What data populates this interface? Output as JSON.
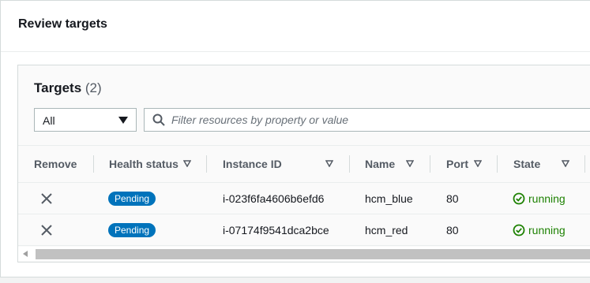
{
  "panel": {
    "title": "Review targets"
  },
  "targets": {
    "title": "Targets",
    "count": "(2)",
    "filter_select": {
      "value": "All",
      "icon": "caret-down-icon"
    },
    "search": {
      "placeholder": "Filter resources by property or value",
      "icon": "search-icon"
    }
  },
  "table": {
    "headers": {
      "remove": "Remove",
      "health": "Health status",
      "instance": "Instance ID",
      "name": "Name",
      "port": "Port",
      "state": "State"
    },
    "rows": [
      {
        "health": "Pending",
        "instance_id": "i-023f6fa4606b6efd6",
        "name": "hcm_blue",
        "port": "80",
        "state": "running"
      },
      {
        "health": "Pending",
        "instance_id": "i-07174f9541dca2bce",
        "name": "hcm_red",
        "port": "80",
        "state": "running"
      }
    ]
  },
  "colors": {
    "badge": "#0073bb",
    "running": "#1d8102",
    "text": "#16191f",
    "muted": "#545b64"
  }
}
